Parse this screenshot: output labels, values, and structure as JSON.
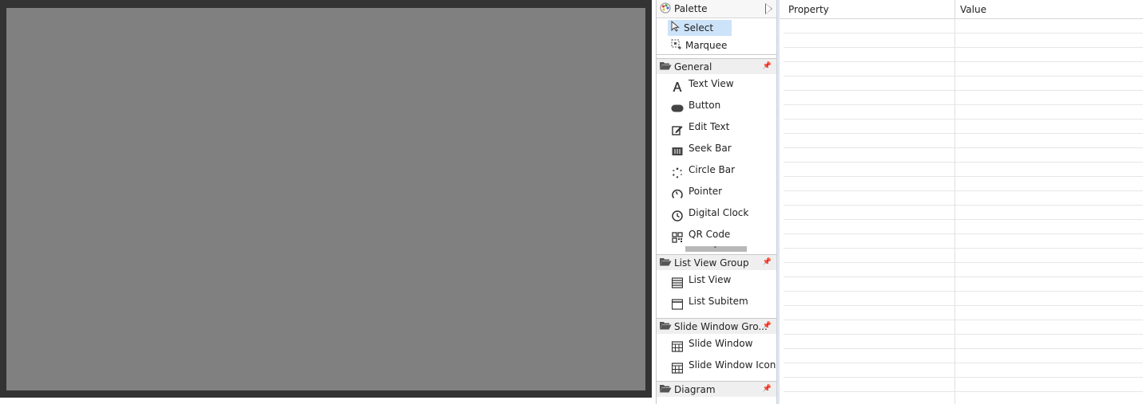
{
  "palette": {
    "title": "Palette",
    "tools": [
      {
        "label": "Select",
        "icon": "cursor-icon",
        "selected": true
      },
      {
        "label": "Marquee",
        "icon": "marquee-icon",
        "selected": false
      }
    ],
    "groups": [
      {
        "label": "General",
        "items": [
          {
            "label": "Text View",
            "icon": "text-view-icon"
          },
          {
            "label": "Button",
            "icon": "button-icon"
          },
          {
            "label": "Edit Text",
            "icon": "edit-text-icon"
          },
          {
            "label": "Seek Bar",
            "icon": "seek-bar-icon"
          },
          {
            "label": "Circle Bar",
            "icon": "circle-bar-icon"
          },
          {
            "label": "Pointer",
            "icon": "pointer-icon"
          },
          {
            "label": "Digital Clock",
            "icon": "clock-icon"
          },
          {
            "label": "QR Code",
            "icon": "qr-code-icon"
          }
        ]
      },
      {
        "label": "List View Group",
        "items": [
          {
            "label": "List View",
            "icon": "list-view-icon"
          },
          {
            "label": "List Subitem",
            "icon": "list-subitem-icon"
          }
        ]
      },
      {
        "label": "Slide Window Gro...",
        "items": [
          {
            "label": "Slide Window",
            "icon": "slide-window-icon"
          },
          {
            "label": "Slide Window Icon",
            "icon": "slide-window-icon"
          }
        ]
      },
      {
        "label": "Diagram",
        "items": []
      }
    ]
  },
  "properties": {
    "columns": [
      "Property",
      "Value"
    ]
  },
  "colors": {
    "canvas": "#808080",
    "canvas_frame": "#333333",
    "selection": "#cde3f9"
  }
}
